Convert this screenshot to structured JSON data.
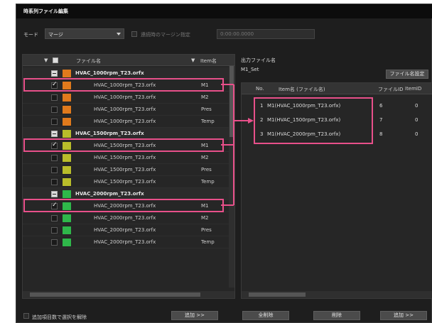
{
  "window": {
    "title": "時系列ファイル編集"
  },
  "mode": {
    "label": "モード",
    "value": "マージ",
    "option_label": "連続時のマージン指定",
    "margin_value": "0:00:00.0000"
  },
  "left_list": {
    "columns": [
      "ファイル名",
      "Item名"
    ],
    "groups": [
      {
        "name": "HVAC_1000rpm_T23.orfx",
        "color": "#e07a1c",
        "rows": [
          {
            "file": "HVAC_1000rpm_T23.orfx",
            "item": "M1",
            "checked": true
          },
          {
            "file": "HVAC_1000rpm_T23.orfx",
            "item": "M2",
            "checked": false
          },
          {
            "file": "HVAC_1000rpm_T23.orfx",
            "item": "Pres",
            "checked": false
          },
          {
            "file": "HVAC_1000rpm_T23.orfx",
            "item": "Temp",
            "checked": false
          }
        ]
      },
      {
        "name": "HVAC_1500rpm_T23.orfx",
        "color": "#b9bd2a",
        "rows": [
          {
            "file": "HVAC_1500rpm_T23.orfx",
            "item": "M1",
            "checked": true
          },
          {
            "file": "HVAC_1500rpm_T23.orfx",
            "item": "M2",
            "checked": false
          },
          {
            "file": "HVAC_1500rpm_T23.orfx",
            "item": "Pres",
            "checked": false
          },
          {
            "file": "HVAC_1500rpm_T23.orfx",
            "item": "Temp",
            "checked": false
          }
        ]
      },
      {
        "name": "HVAC_2000rpm_T23.orfx",
        "color": "#2fb84a",
        "rows": [
          {
            "file": "HVAC_2000rpm_T23.orfx",
            "item": "M1",
            "checked": true
          },
          {
            "file": "HVAC_2000rpm_T23.orfx",
            "item": "M2",
            "checked": false
          },
          {
            "file": "HVAC_2000rpm_T23.orfx",
            "item": "Pres",
            "checked": false
          },
          {
            "file": "HVAC_2000rpm_T23.orfx",
            "item": "Temp",
            "checked": false
          }
        ]
      }
    ]
  },
  "output": {
    "label": "出力ファイル名",
    "name": "M1_Set",
    "rename_button": "ファイル名設定",
    "columns": [
      "No.",
      "Item名 (ファイル名)",
      "ファイルID",
      "ItemID"
    ],
    "rows": [
      {
        "no": "1",
        "name": "M1(HVAC_1000rpm_T23.orfx)",
        "file_id": "6",
        "item_id": "0"
      },
      {
        "no": "2",
        "name": "M1(HVAC_1500rpm_T23.orfx)",
        "file_id": "7",
        "item_id": "0"
      },
      {
        "no": "3",
        "name": "M1(HVAC_2000rpm_T23.orfx)",
        "file_id": "8",
        "item_id": "0"
      }
    ]
  },
  "footer": {
    "checkbox_label": "追加項目数で選択を解除",
    "add_left": "追加 >>",
    "delete_all": "全削除",
    "delete": "削除",
    "add_right": "追加 >>"
  },
  "colors": {
    "highlight": "#e8508a",
    "background": "#1e1e1e"
  }
}
